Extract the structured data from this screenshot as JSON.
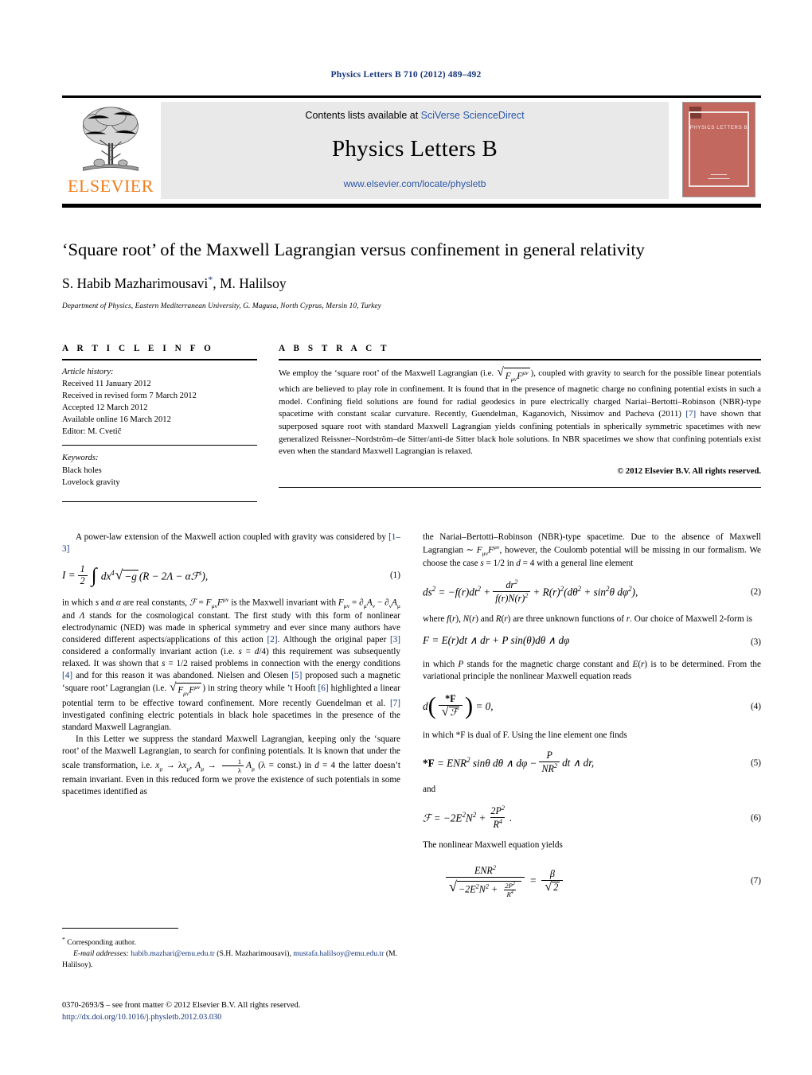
{
  "running_head": "Physics Letters B 710 (2012) 489–492",
  "masthead": {
    "contents_prefix": "Contents lists available at ",
    "contents_link": "SciVerse ScienceDirect",
    "journal_name": "Physics Letters B",
    "journal_url": "www.elsevier.com/locate/physletb",
    "publisher": "ELSEVIER",
    "cover_title": "PHYSICS LETTERS B",
    "cover_footer": "Available online at\nScienceDirect",
    "colors": {
      "publisher_orange": "#f07d1a",
      "cover_red": "#c2685f",
      "link_blue": "#2b57a6"
    }
  },
  "title": "‘Square root’ of the Maxwell Lagrangian versus confinement in general relativity",
  "authors": "S. Habib Mazharimousavi",
  "authors_tail": ", M. Halilsoy",
  "author_star": "*",
  "affiliation": "Department of Physics, Eastern Mediterranean University, G. Magusa, North Cyprus, Mersin 10, Turkey",
  "article_info": {
    "heading": "A R T I C L E    I N F O",
    "history_label": "Article history:",
    "history": [
      "Received 11 January 2012",
      "Received in revised form 7 March 2012",
      "Accepted 12 March 2012",
      "Available online 16 March 2012",
      "Editor: M. Cvetič"
    ],
    "keywords_label": "Keywords:",
    "keywords": [
      "Black holes",
      "Lovelock gravity"
    ]
  },
  "abstract": {
    "heading": "A B S T R A C T",
    "part1": "We employ the ‘square root’ of the Maxwell Lagrangian (i.e. ",
    "part2": "), coupled with gravity to search for the possible linear potentials which are believed to play role in confinement. It is found that in the presence of magnetic charge no confining potential exists in such a model. Confining field solutions are found for radial geodesics in pure electrically charged Nariai–Bertotti–Robinson (NBR)-type spacetime with constant scalar curvature. Recently, Guendelman, Kaganovich, Nissimov and Pacheva (2011) ",
    "ref7": "[7]",
    "part3": " have shown that superposed square root with standard Maxwell Lagrangian yields confining potentials in spherically symmetric spacetimes with new generalized Reissner–Nordström–de Sitter/anti-de Sitter black hole solutions. In NBR spacetimes we show that confining potentials exist even when the standard Maxwell Lagrangian is relaxed.",
    "copyright": "© 2012 Elsevier B.V. All rights reserved."
  },
  "body": {
    "left": {
      "p1_a": "A power-law extension of the Maxwell action coupled with gravity was considered by ",
      "p1_ref": "[1–3]",
      "p2_a": "in which ",
      "p2_b": " and ",
      "p2_c": " are real constants, ",
      "p2_d": " is the Maxwell invariant with ",
      "p2_e": " and ",
      "p2_f": " stands for the cosmological constant. The first study with this form of nonlinear electrodynamic (NED) was made in spherical symmetry and ever since many authors have considered different aspects/applications of this action ",
      "p2_ref2": "[2]",
      "p2_g": ". Although the original paper ",
      "p2_ref3": "[3]",
      "p2_h": " considered a conformally invariant action (i.e. ",
      "p2_i": ") this requirement was subsequently relaxed. It was shown that ",
      "p2_j": " raised problems in connection with the energy conditions ",
      "p2_ref4": "[4]",
      "p2_k": " and for this reason it was abandoned. Nielsen and Olesen ",
      "p2_ref5": "[5]",
      "p2_l": " proposed such a magnetic ‘square root’ Lagrangian (i.e. ",
      "p2_m": ") in string theory while ’t Hooft ",
      "p2_ref6": "[6]",
      "p2_n": " highlighted a linear potential term to be effective toward confinement. More recently Guendelman et al. ",
      "p2_ref7": "[7]",
      "p2_o": " investigated confining electric potentials in black hole spacetimes in the presence of the standard Maxwell Lagrangian.",
      "p3_a": "In this Letter we suppress the standard Maxwell Lagrangian, keeping only the ‘square root’ of the Maxwell Lagrangian, to search for confining potentials. It is known that under the scale transformation, i.e. ",
      "p3_b": " in ",
      "p3_c": " the latter doesn’t remain invariant. Even in this reduced form we prove the existence of such potentials in some spacetimes identified as"
    },
    "right": {
      "p1_a": "the Nariai–Bertotti–Robinson (NBR)-type spacetime. Due to the absence of Maxwell Lagrangian ",
      "p1_b": ", however, the Coulomb potential will be missing in our formalism. We choose the case ",
      "p1_c": " in ",
      "p1_d": " with a general line element",
      "p2_a": "where ",
      "p2_b": ", ",
      "p2_c": " and ",
      "p2_d": " are three unknown functions of ",
      "p2_e": ". Our choice of Maxwell 2-form is",
      "p3_a": "in which ",
      "p3_b": " stands for the magnetic charge constant and ",
      "p3_c": " is to be determined. From the variational principle the nonlinear Maxwell equation reads",
      "p4_a": "in which *F is dual of F. Using the line element one finds",
      "p5": "and",
      "p6": "The nonlinear Maxwell equation yields"
    }
  },
  "equation_numbers": {
    "e1": "(1)",
    "e2": "(2)",
    "e3": "(3)",
    "e4": "(4)",
    "e5": "(5)",
    "e6": "(6)",
    "e7": "(7)"
  },
  "footnote": {
    "star": "*",
    "corresponding": "Corresponding author.",
    "email_label": "E-mail addresses:",
    "email1": "habib.mazhari@emu.edu.tr",
    "email1_name": " (S.H. Mazharimousavi),",
    "email2": "mustafa.halilsoy@emu.edu.tr",
    "email2_name": " (M. Halilsoy)."
  },
  "imprint": {
    "line1": "0370-2693/$ – see front matter © 2012 Elsevier B.V. All rights reserved.",
    "doi": "http://dx.doi.org/10.1016/j.physletb.2012.03.030"
  }
}
